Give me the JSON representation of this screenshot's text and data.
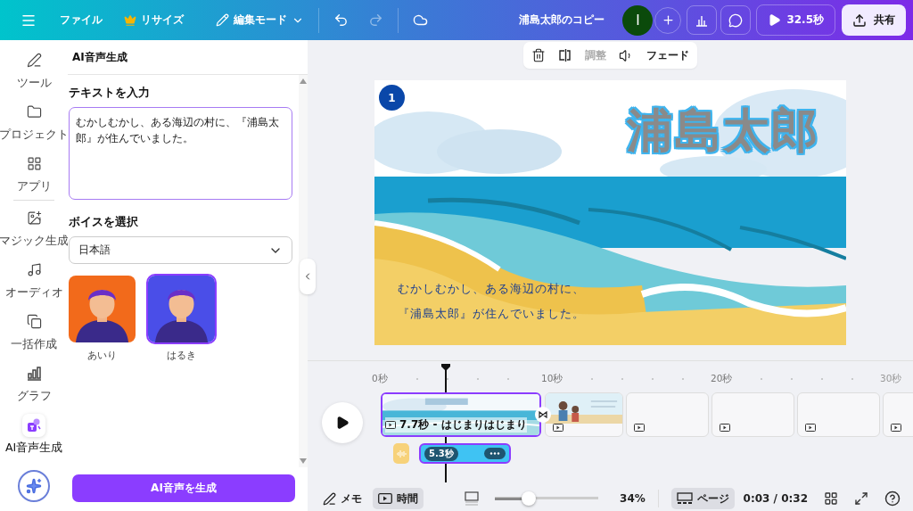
{
  "topbar": {
    "file": "ファイル",
    "resize": "リサイズ",
    "edit_mode": "編集モード",
    "title": "浦島太郎のコピー",
    "avatar": "I",
    "play": "32.5秒",
    "share": "共有"
  },
  "rail": [
    {
      "kind": "tools",
      "label": "ツール",
      "selected": false
    },
    {
      "kind": "project",
      "label": "プロジェクト",
      "selected": false
    },
    {
      "kind": "apps",
      "label": "アプリ",
      "selected": false
    },
    {
      "kind": "magic",
      "label": "マジック生成",
      "selected": false
    },
    {
      "kind": "audio",
      "label": "オーディオ",
      "selected": false
    },
    {
      "kind": "bulk",
      "label": "一括作成",
      "selected": false
    },
    {
      "kind": "chart",
      "label": "グラフ",
      "selected": false
    },
    {
      "kind": "voice",
      "label": "AI音声生成",
      "selected": true
    }
  ],
  "panel": {
    "title": "AI音声生成",
    "text_label": "テキストを入力",
    "text_value": "むかしむかし、ある海辺の村に、『浦島太郎』が住んでいました。",
    "voice_label": "ボイスを選択",
    "language": "日本語",
    "voices": [
      {
        "name": "あいり",
        "selected": false,
        "color": "#f26a1b"
      },
      {
        "name": "はるき",
        "selected": true,
        "color": "#4a4ee8"
      }
    ],
    "generate": "AI音声を生成"
  },
  "context_toolbar": {
    "adjust": "調整",
    "adjust_disabled": true,
    "fade": "フェード"
  },
  "slide": {
    "number": "1",
    "title": "浦島太郎",
    "lines": [
      "むかしむかし、ある海辺の村に、",
      "『浦島太郎』が住んでいました。"
    ]
  },
  "timeline": {
    "ticks": [
      "0秒",
      "10秒",
      "20秒",
      "30秒"
    ],
    "clips": [
      {
        "kind": "slide",
        "label": "7.7秒 - はじまりはじまり",
        "selected": true
      },
      {
        "kind": "picture",
        "selected": false
      },
      {
        "kind": "blank",
        "selected": false
      },
      {
        "kind": "blank",
        "selected": false
      },
      {
        "kind": "blank",
        "selected": false
      },
      {
        "kind": "blank",
        "selected": false
      }
    ],
    "audio": {
      "duration": "5.3秒",
      "selected": true
    }
  },
  "bottombar": {
    "notes": "メモ",
    "timer": "時間",
    "timer_selected": true,
    "zoom": {
      "level": 0.33
    },
    "zoom_reading": "34%",
    "pages": "ページ",
    "pages_selected": true,
    "time": "0:03 / 0:32"
  }
}
